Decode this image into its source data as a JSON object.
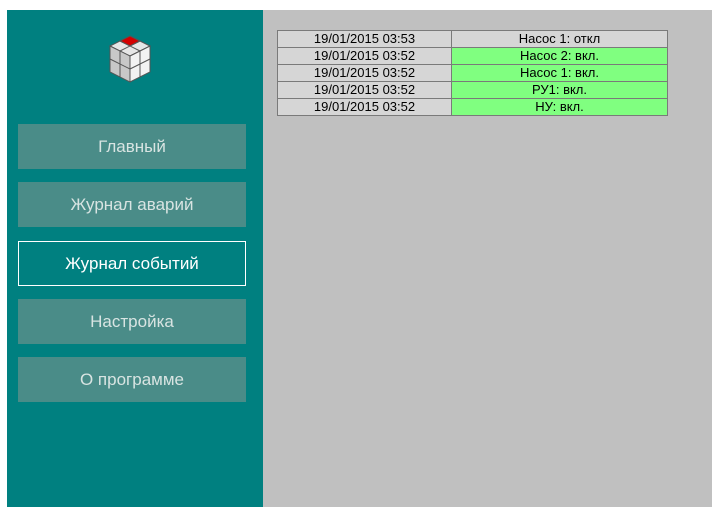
{
  "sidebar": {
    "logo_icon": "cube-logo-icon",
    "colors": {
      "background": "#008080",
      "button": "#4a8c88",
      "active_border": "#ffffff"
    },
    "nav": [
      {
        "label": "Главный",
        "active": false
      },
      {
        "label": "Журнал аварий",
        "active": false
      },
      {
        "label": "Журнал событий",
        "active": true
      },
      {
        "label": "Настройка",
        "active": false
      },
      {
        "label": "О программе",
        "active": false
      }
    ]
  },
  "event_log": {
    "colors": {
      "on": "#80ff80",
      "off": "#d6d6d6"
    },
    "rows": [
      {
        "time": "19/01/2015 03:53",
        "event": "Насос 1: откл",
        "state": "off"
      },
      {
        "time": "19/01/2015 03:52",
        "event": "Насос 2: вкл.",
        "state": "on"
      },
      {
        "time": "19/01/2015 03:52",
        "event": "Насос 1: вкл.",
        "state": "on"
      },
      {
        "time": "19/01/2015 03:52",
        "event": "РУ1: вкл.",
        "state": "on"
      },
      {
        "time": "19/01/2015 03:52",
        "event": "НУ: вкл.",
        "state": "on"
      }
    ]
  }
}
